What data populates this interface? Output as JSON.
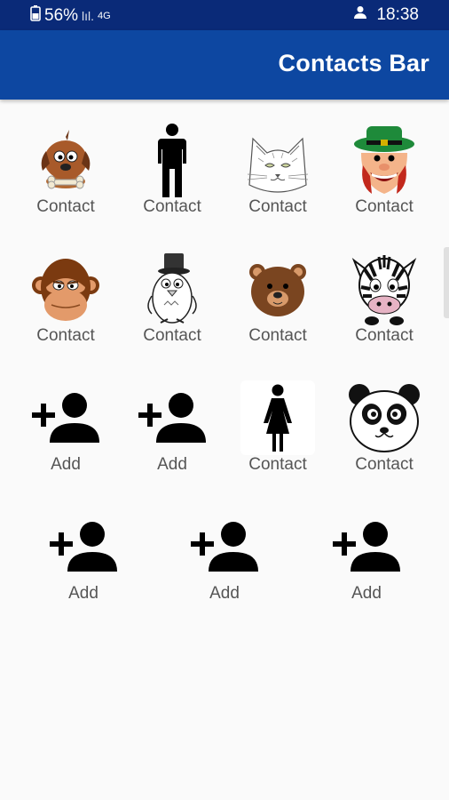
{
  "status": {
    "battery": "56%",
    "signal": "lıl.",
    "net": "4G",
    "time": "18:38"
  },
  "appbar": {
    "title": "Contacts Bar"
  },
  "grid": {
    "r1": [
      "Contact",
      "Contact",
      "Contact",
      "Contact"
    ],
    "r2": [
      "Contact",
      "Contact",
      "Contact",
      "Contact"
    ],
    "r3": [
      "Add",
      "Add",
      "Contact",
      "Contact"
    ],
    "r4": [
      "Add",
      "Add",
      "Add"
    ]
  },
  "icons": {
    "r1": [
      "dog-icon",
      "man-icon",
      "cat-icon",
      "leprechaun-icon"
    ],
    "r2": [
      "monkey-icon",
      "penguin-icon",
      "bear-icon",
      "zebra-icon"
    ],
    "r3": [
      "add-contact-icon",
      "add-contact-icon",
      "woman-icon",
      "panda-icon"
    ],
    "r4": [
      "add-contact-icon",
      "add-contact-icon",
      "add-contact-icon"
    ]
  },
  "colors": {
    "statusbar": "#0a2a78",
    "appbar": "#0d47a1"
  }
}
